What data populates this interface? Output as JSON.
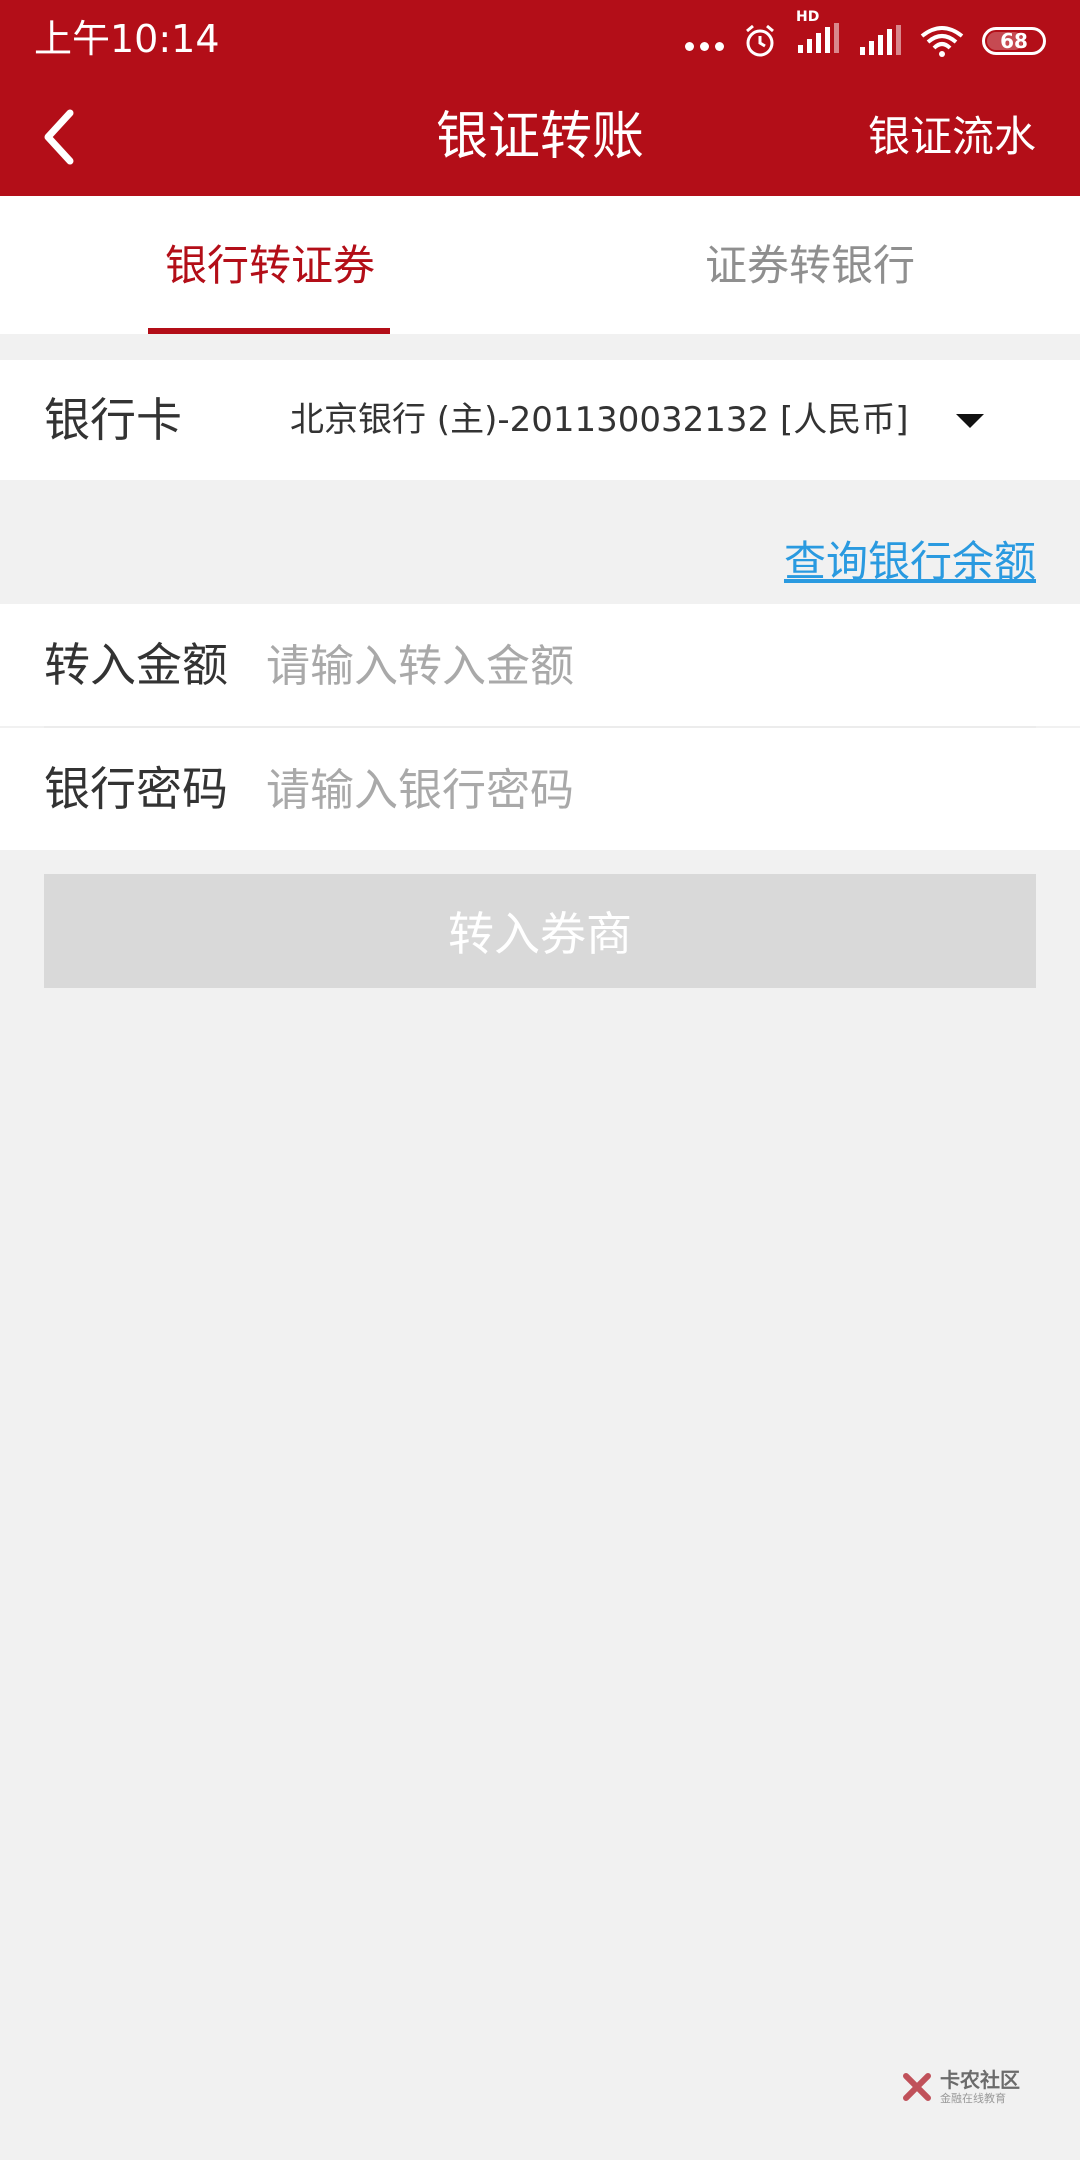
{
  "status_bar": {
    "time": "上午10:14",
    "network_label": "HD",
    "battery": "68",
    "battery_level": 0.68
  },
  "nav": {
    "title": "银证转账",
    "right_action": "银证流水"
  },
  "tabs": [
    {
      "label": "银行转证券",
      "active": true
    },
    {
      "label": "证券转银行",
      "active": false
    }
  ],
  "bank_card": {
    "label": "银行卡",
    "value": "北京银行 (主)-201130032132 [人民币]"
  },
  "query_balance_link": "查询银行余额",
  "amount": {
    "label": "转入金额",
    "placeholder": "请输入转入金额"
  },
  "password": {
    "label": "银行密码",
    "placeholder": "请输入银行密码"
  },
  "submit_label": "转入券商",
  "watermark": {
    "title": "卡农社区",
    "subtitle": "金融在线教育"
  },
  "colors": {
    "brand": "#b30e18",
    "link": "#2a9ae0",
    "disabled_button": "#d9d9d9"
  }
}
